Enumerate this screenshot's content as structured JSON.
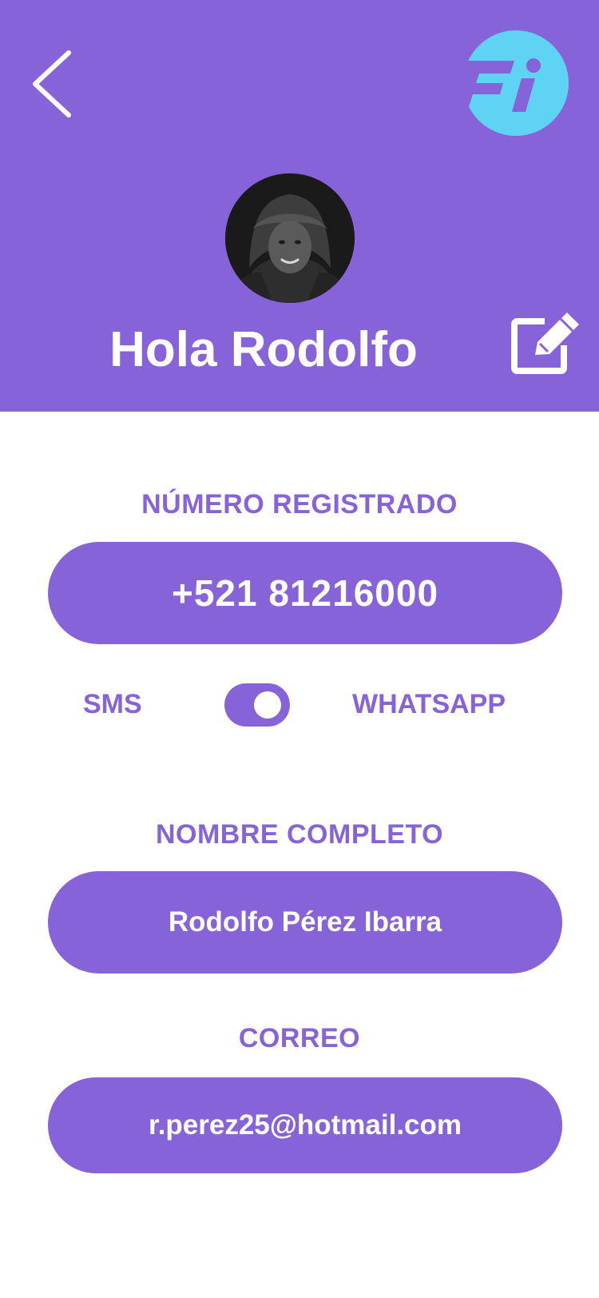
{
  "header": {
    "greeting": "Hola Rodolfo",
    "back_icon": "chevron-left-icon",
    "logo_text": "Fi",
    "edit_icon": "edit-icon",
    "background_color": "#8663d8",
    "logo_color": "#5fd3f4"
  },
  "phone": {
    "label": "NÚMERO REGISTRADO",
    "value": "+521 81216000"
  },
  "channel_toggle": {
    "left_label": "SMS",
    "right_label": "WHATSAPP",
    "selected": "WHATSAPP"
  },
  "full_name": {
    "label": "NOMBRE COMPLETO",
    "value": "Rodolfo Pérez Ibarra"
  },
  "email": {
    "label": "CORREO",
    "value": "r.perez25@hotmail.com"
  }
}
